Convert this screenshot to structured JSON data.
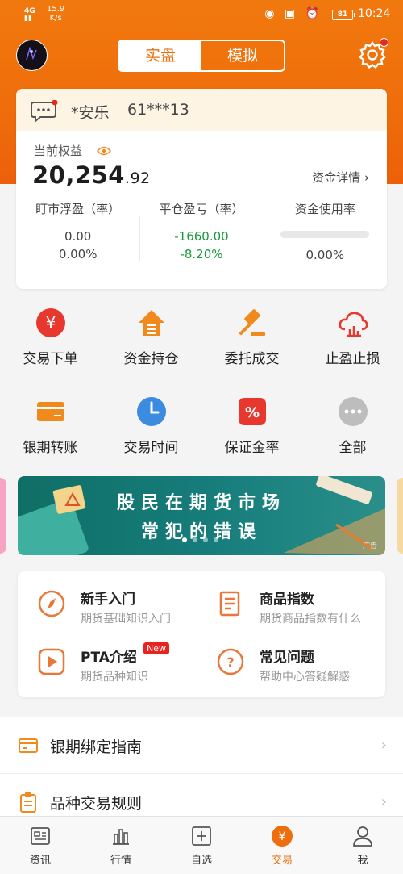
{
  "status": {
    "signal": "4G",
    "speed_value": "15.9",
    "speed_unit": "K/s",
    "battery": "81",
    "time": "10:24"
  },
  "header": {
    "tab_real": "实盘",
    "tab_sim": "模拟"
  },
  "account": {
    "name": "*安乐",
    "id": "61***13",
    "equity_label": "当前权益",
    "equity_int": "20,254",
    "equity_dec": ".92",
    "detail_link": "资金详情"
  },
  "stats": [
    {
      "label": "盯市浮盈（率）",
      "value": "0.00",
      "rate": "0.00%"
    },
    {
      "label": "平仓盈亏（率）",
      "value": "-1660.00",
      "rate": "-8.20%"
    },
    {
      "label": "资金使用率",
      "usage_fraction": 0,
      "rate": "0.00%"
    }
  ],
  "grid": [
    {
      "label": "交易下单",
      "icon": "yen-icon",
      "color": "#e8372e"
    },
    {
      "label": "资金持仓",
      "icon": "house-coins-icon",
      "color": "#f08a1c"
    },
    {
      "label": "委托成交",
      "icon": "gavel-icon",
      "color": "#f08a1c"
    },
    {
      "label": "止盈止损",
      "icon": "cloud-chart-icon",
      "color": "#e8372e"
    },
    {
      "label": "银期转账",
      "icon": "card-icon",
      "color": "#f08a1c"
    },
    {
      "label": "交易时间",
      "icon": "clock-icon",
      "color": "#3b8be0"
    },
    {
      "label": "保证金率",
      "icon": "percent-icon",
      "color": "#e8372e"
    },
    {
      "label": "全部",
      "icon": "more-icon",
      "color": "#bdbdbd"
    }
  ],
  "banner": {
    "line1": "股民在期货市场",
    "line2": "常犯的错误",
    "ad": "广告"
  },
  "panel": [
    {
      "title": "新手入门",
      "sub": "期货基础知识入门",
      "icon": "compass-icon"
    },
    {
      "title": "商品指数",
      "sub": "期货商品指数有什么",
      "icon": "document-icon"
    },
    {
      "title": "PTA介绍",
      "sub": "期货品种知识",
      "icon": "play-icon",
      "badge": "New"
    },
    {
      "title": "常见问题",
      "sub": "帮助中心答疑解惑",
      "icon": "question-icon"
    }
  ],
  "rows": [
    {
      "title": "银期绑定指南",
      "icon": "bank-card-icon"
    },
    {
      "title": "品种交易规则",
      "icon": "clipboard-icon"
    }
  ],
  "tabs": [
    {
      "label": "资讯",
      "icon": "news-icon"
    },
    {
      "label": "行情",
      "icon": "market-icon"
    },
    {
      "label": "自选",
      "icon": "add-icon"
    },
    {
      "label": "交易",
      "icon": "trade-icon",
      "active": true
    },
    {
      "label": "我",
      "icon": "user-icon"
    }
  ],
  "colors": {
    "brand": "#ef6d0b",
    "loss": "#1a9a3c",
    "badge": "#e9221f"
  }
}
